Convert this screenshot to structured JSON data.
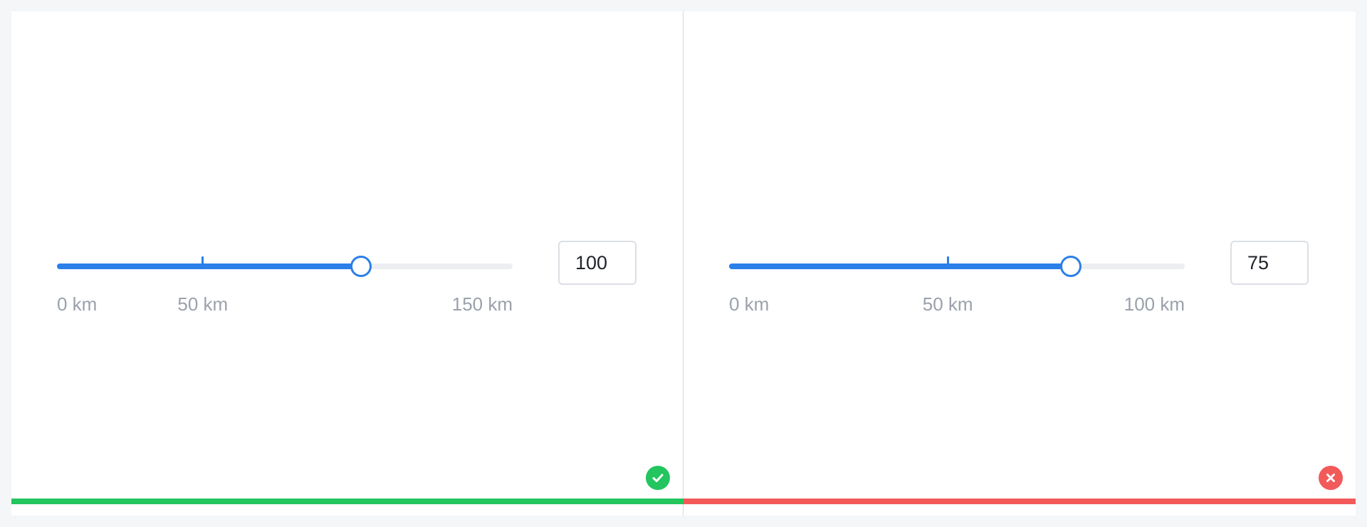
{
  "panels": [
    {
      "slider": {
        "min": 0,
        "max": 150,
        "value": 100,
        "tick_value": 50,
        "marks": [
          "0 km",
          "50 km",
          "150 km"
        ],
        "mark_values": [
          0,
          50,
          150
        ]
      },
      "input_value": "100",
      "status": "correct",
      "status_icon": "check-icon",
      "status_color": "#22c55e"
    },
    {
      "slider": {
        "min": 0,
        "max": 100,
        "value": 75,
        "tick_value": 50,
        "marks": [
          "0 km",
          "50 km",
          "100 km"
        ],
        "mark_values": [
          0,
          50,
          100
        ]
      },
      "input_value": "75",
      "status": "incorrect",
      "status_icon": "close-icon",
      "status_color": "#f25a5a"
    }
  ],
  "colors": {
    "accent": "#2b7fe9",
    "rail": "#eceef1",
    "mark_text": "#9aa1ab"
  }
}
